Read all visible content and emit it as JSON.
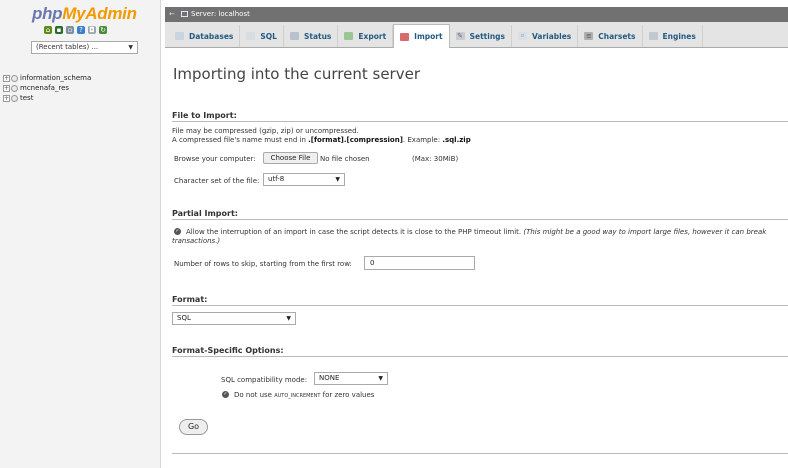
{
  "sidebar": {
    "logo_part1": "php",
    "logo_part2": "MyAdmin",
    "recent_tables": "(Recent tables) ...",
    "databases": [
      "information_schema",
      "mcnenafa_res",
      "test"
    ]
  },
  "topbar": {
    "server_label": "Server: localhost"
  },
  "tabs": [
    {
      "label": "Databases",
      "icon": "database-icon"
    },
    {
      "label": "SQL",
      "icon": "sql-icon"
    },
    {
      "label": "Status",
      "icon": "status-icon"
    },
    {
      "label": "Export",
      "icon": "export-icon"
    },
    {
      "label": "Import",
      "icon": "import-icon",
      "active": true
    },
    {
      "label": "Settings",
      "icon": "settings-icon"
    },
    {
      "label": "Variables",
      "icon": "variables-icon"
    },
    {
      "label": "Charsets",
      "icon": "charsets-icon"
    },
    {
      "label": "Engines",
      "icon": "engines-icon"
    }
  ],
  "main": {
    "title": "Importing into the current server",
    "file_section": {
      "title": "File to Import:",
      "note1": "File may be compressed (gzip, zip) or uncompressed.",
      "note2_pre": "A compressed file's name must end in ",
      "note2_bold": ".[format].[compression]",
      "note2_mid": ". Example: ",
      "note2_example": ".sql.zip",
      "browse_label": "Browse your computer:",
      "choose_button": "Choose File",
      "no_file": "No file chosen",
      "max_size": "(Max: 30MiB)",
      "charset_label": "Character set of the file:",
      "charset_value": "utf-8"
    },
    "partial_section": {
      "title": "Partial Import:",
      "allow_interrupt_text": "Allow the interruption of an import in case the script detects it is close to the PHP timeout limit.",
      "allow_interrupt_note": "(This might be a good way to import large files, however it can break",
      "allow_interrupt_note2": "transactions.)",
      "skip_label": "Number of rows to skip, starting from the first row:",
      "skip_value": "0"
    },
    "format_section": {
      "title": "Format:",
      "format_value": "SQL"
    },
    "options_section": {
      "title": "Format-Specific Options:",
      "compat_label": "SQL compatibility mode:",
      "compat_value": "NONE",
      "auto_inc_pre": "Do not use ",
      "auto_inc_code": "AUTO_INCREMENT",
      "auto_inc_post": " for zero values"
    },
    "go_button": "Go"
  }
}
